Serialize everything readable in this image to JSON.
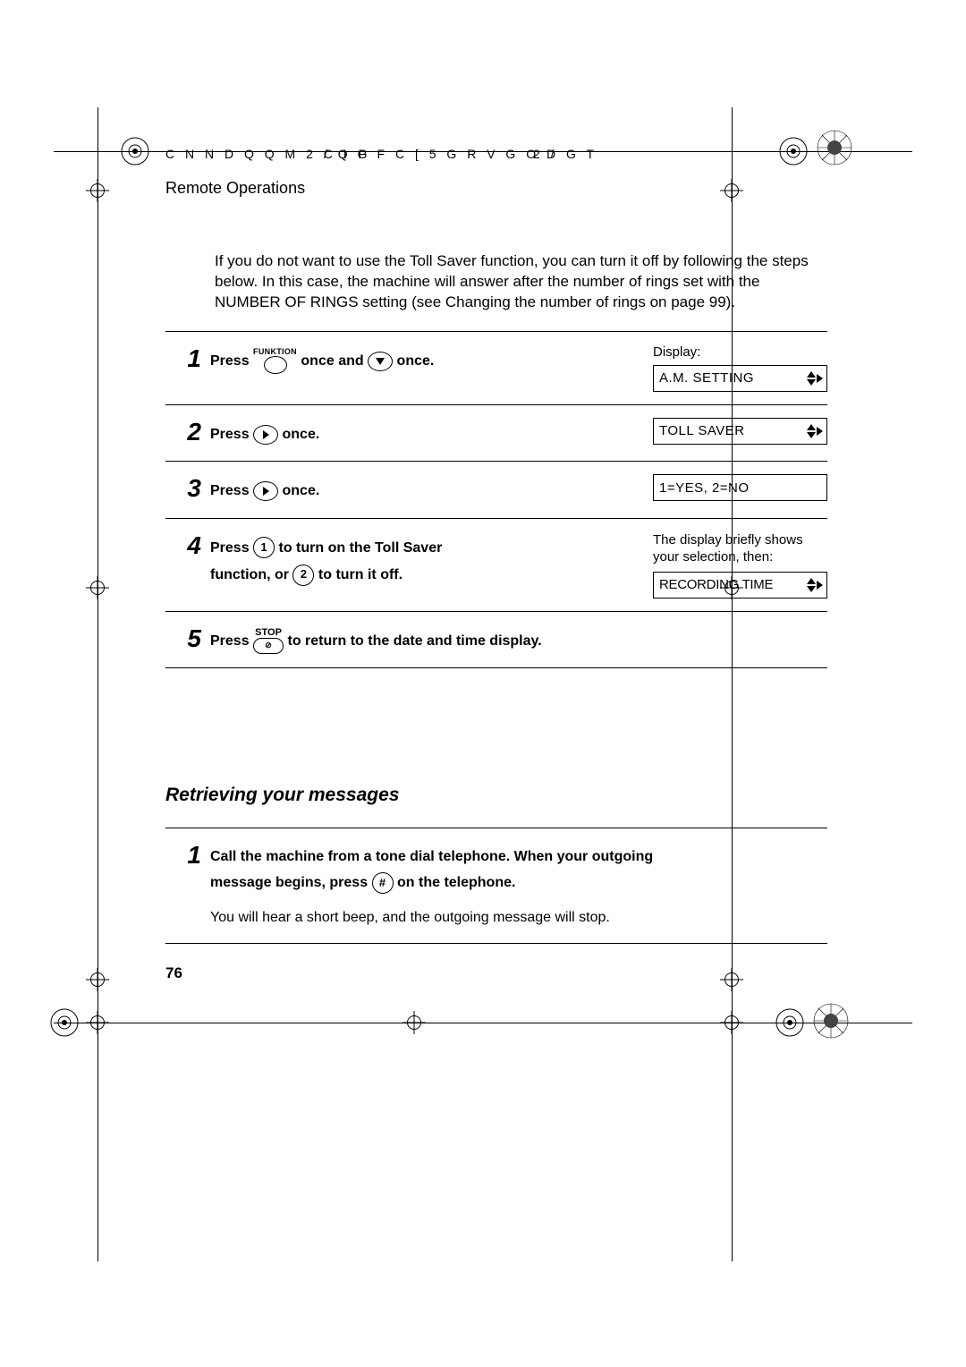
{
  "header": {
    "code_left": "C N N   D Q Q M     2 C I G",
    "code_mid": "/ Q P F C [     5 G R V G O D G T",
    "code_right": "2 /"
  },
  "section_title": "Remote Operations",
  "intro": "If you do not want to use the Toll Saver function, you can turn it off by following the steps below. In this case, the machine will answer after the number of rings set with the NUMBER OF RINGS setting (see Changing the number of rings on page 99).",
  "steps": [
    {
      "num": "1",
      "press": "Press",
      "funktion_label": "FUNKTION",
      "mid1": "once and",
      "mid2": "once.",
      "display_label": "Display:",
      "lcd": "A.M. SETTING"
    },
    {
      "num": "2",
      "press": "Press",
      "mid2": "once.",
      "lcd": "TOLL SAVER"
    },
    {
      "num": "3",
      "press": "Press",
      "mid2": "once.",
      "lcd": "1=YES, 2=NO"
    },
    {
      "num": "4",
      "press": "Press",
      "key1_label": "1",
      "mid_a": "to turn on the Toll Saver",
      "line2a": "function, or",
      "key2_label": "2",
      "line2b": "to turn it off.",
      "note_a": "The display briefly shows",
      "note_b": "your selection, then:",
      "lcd": "RECORDING TIME"
    },
    {
      "num": "5",
      "press": "Press",
      "stop_label": "STOP",
      "mid2": "to return to the date and time display."
    }
  ],
  "subheading": "Retrieving your messages",
  "retrieve": {
    "num": "1",
    "line1": "Call the machine from a tone dial telephone. When your outgoing",
    "line2a": "message begins, press",
    "hash": "#",
    "line2b": "on the telephone.",
    "note": "You will hear a short beep, and the outgoing message will stop."
  },
  "page_number": "76"
}
